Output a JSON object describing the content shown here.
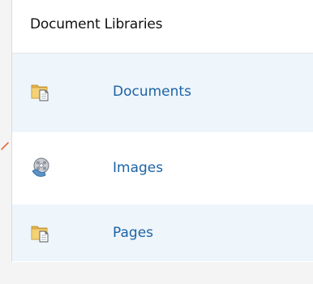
{
  "header": {
    "title": "Document Libraries"
  },
  "libraries": [
    {
      "label": "Documents",
      "icon": "document-library-icon"
    },
    {
      "label": "Images",
      "icon": "picture-library-icon"
    },
    {
      "label": "Pages",
      "icon": "document-library-icon"
    }
  ],
  "colors": {
    "link": "#1d63a4",
    "alt_row": "#eef5fb",
    "marker": "#e06b3f"
  }
}
